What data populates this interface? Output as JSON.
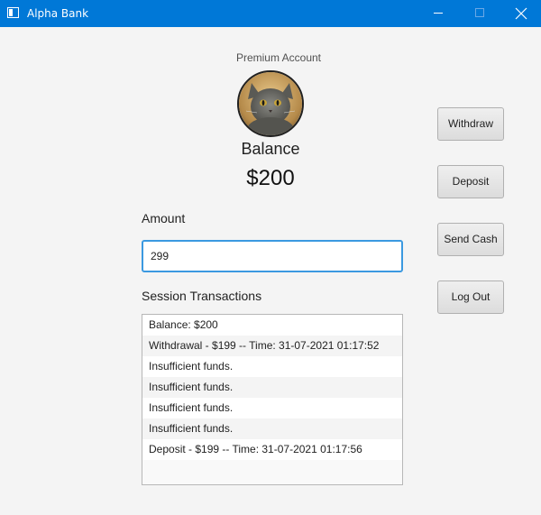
{
  "window": {
    "title": "Alpha Bank",
    "accent_color": "#0078d7"
  },
  "header": {
    "account_type": "Premium Account",
    "avatar": "cat-photo",
    "balance_label": "Balance",
    "balance_value": "$200"
  },
  "amount": {
    "label": "Amount",
    "value": "299"
  },
  "transactions": {
    "label": "Session Transactions",
    "items": [
      "Balance: $200",
      "Withdrawal - $199 -- Time: 31-07-2021 01:17:52",
      "Insufficient funds.",
      "Insufficient funds.",
      "Insufficient funds.",
      "Insufficient funds.",
      "Deposit - $199 -- Time: 31-07-2021 01:17:56"
    ]
  },
  "actions": {
    "withdraw": "Withdraw",
    "deposit": "Deposit",
    "send_cash": "Send Cash",
    "log_out": "Log Out"
  }
}
